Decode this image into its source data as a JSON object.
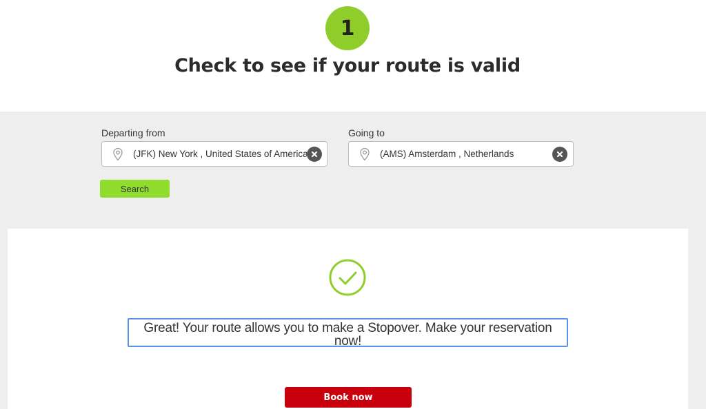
{
  "header": {
    "step_number": "1",
    "title": "Check to see if your route is valid"
  },
  "search": {
    "departing": {
      "label": "Departing from",
      "value": "(JFK) New York , United States of America",
      "icon": "map-pin-icon",
      "clear_icon": "clear-icon"
    },
    "going": {
      "label": "Going to",
      "value": "(AMS) Amsterdam , Netherlands",
      "icon": "map-pin-icon",
      "clear_icon": "clear-icon"
    },
    "search_label": "Search"
  },
  "result": {
    "icon": "check-circle-icon",
    "message": "Great! Your route allows you to make a Stopover. Make your reservation now!",
    "book_label": "Book now"
  },
  "colors": {
    "accent_green": "#8fce2a",
    "search_green": "#8fdc2e",
    "book_red": "#c8000e",
    "focus_blue": "#5b93ec"
  }
}
